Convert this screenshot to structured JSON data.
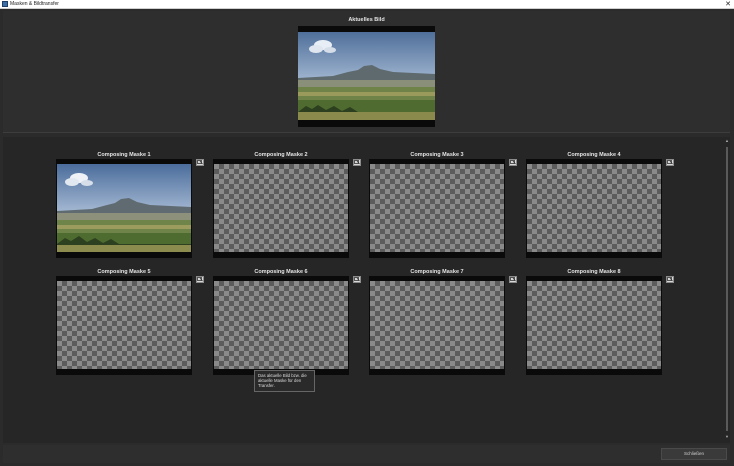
{
  "window": {
    "title": "Masken & Bildtransfer",
    "close_glyph": "✕"
  },
  "current_image": {
    "label": "Aktuelles Bild"
  },
  "masks": [
    {
      "label": "Composing Maske 1",
      "has_image": true
    },
    {
      "label": "Composing Maske 2",
      "has_image": false
    },
    {
      "label": "Composing Maske 3",
      "has_image": false
    },
    {
      "label": "Composing Maske 4",
      "has_image": false
    },
    {
      "label": "Composing Maske 5",
      "has_image": false
    },
    {
      "label": "Composing Maske 6",
      "has_image": false
    },
    {
      "label": "Composing Maske 7",
      "has_image": false
    },
    {
      "label": "Composing Maske 8",
      "has_image": false
    }
  ],
  "tooltip": {
    "text": "Das aktuelle Bild bzw. die aktuelle Maske für den Transfer."
  },
  "footer": {
    "close_label": "Schließen"
  },
  "colors": {
    "background": "#2b2b2b",
    "panel": "#2e2e2e",
    "text": "#e6e6e6"
  },
  "icons": {
    "transfer": "transfer-icon",
    "close": "close-icon"
  }
}
